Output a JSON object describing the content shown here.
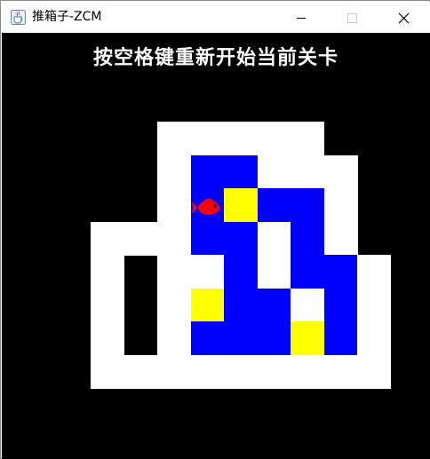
{
  "window": {
    "title": "推箱子-ZCM",
    "icon": "java-cup-icon",
    "controls": [
      "minimize-icon",
      "maximize-icon",
      "close-icon"
    ]
  },
  "game": {
    "hint": "按空格键重新开始当前关卡",
    "colors": {
      "background": "#000000",
      "wall": "#ffffff",
      "floor": "#0000ff",
      "box": "#ffff00",
      "player": "#ff0000"
    },
    "legend": {
      "W": "wall",
      ".": "floor",
      "B": "box",
      "P": "player",
      " ": "empty"
    },
    "level": [
      "  WWWWW ",
      "  W..WWW",
      "  WPB..W",
      "WWW..W.W",
      "W WW.W..W",
      "W WB..W.W",
      "W W...B.W",
      "WWWWWWWWW"
    ]
  }
}
